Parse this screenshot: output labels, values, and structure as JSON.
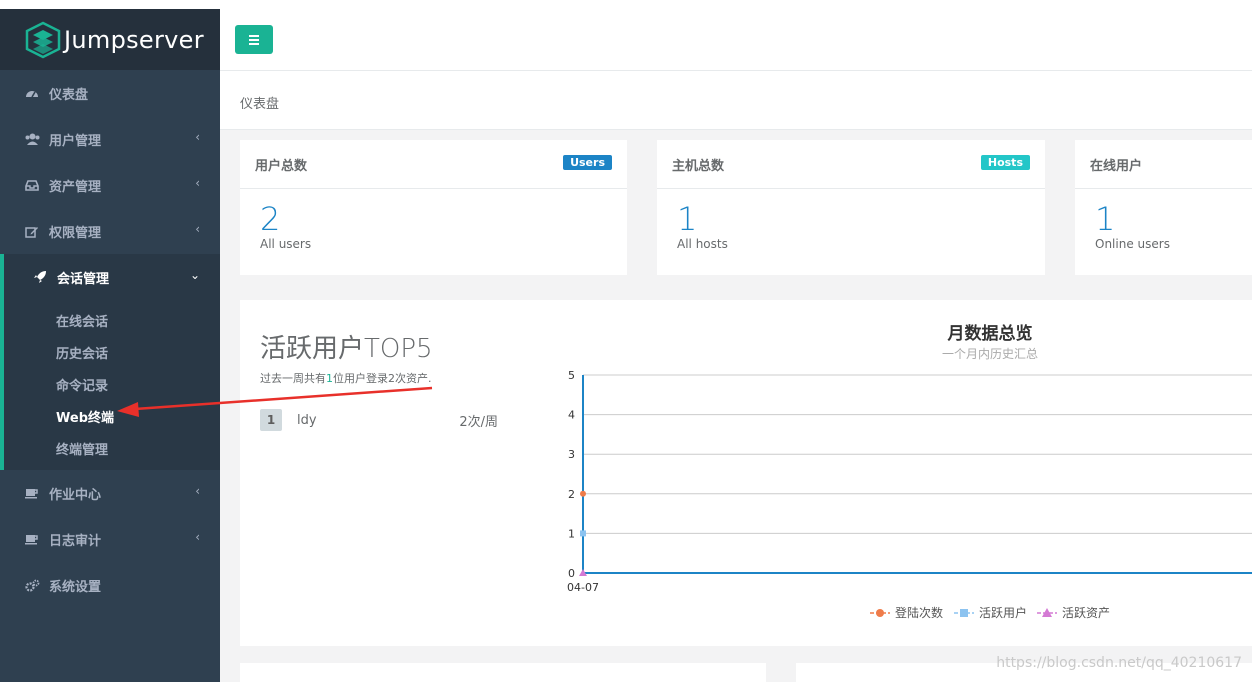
{
  "brand": {
    "name": "Jumpserver"
  },
  "sidebar": {
    "items": [
      {
        "label": "仪表盘",
        "icon": "dashboard-icon"
      },
      {
        "label": "用户管理",
        "icon": "users-icon"
      },
      {
        "label": "资产管理",
        "icon": "inbox-icon"
      },
      {
        "label": "权限管理",
        "icon": "edit-icon"
      },
      {
        "label": "会话管理",
        "icon": "rocket-icon"
      },
      {
        "label": "作业中心",
        "icon": "coffee-icon"
      },
      {
        "label": "日志审计",
        "icon": "log-icon"
      },
      {
        "label": "系统设置",
        "icon": "gears-icon"
      }
    ],
    "sub_items": [
      "在线会话",
      "历史会话",
      "命令记录",
      "Web终端",
      "终端管理"
    ],
    "chevron": "‹",
    "chevron_open": "⌄"
  },
  "breadcrumb": "仪表盘",
  "cards": [
    {
      "title": "用户总数",
      "badge": "Users",
      "badge_color": "#1c84c6",
      "value": "2",
      "label": "All users"
    },
    {
      "title": "主机总数",
      "badge": "Hosts",
      "badge_color": "#23c6c8",
      "value": "1",
      "label": "All hosts"
    },
    {
      "title": "在线用户",
      "value": "1",
      "label": "Online users"
    }
  ],
  "top5": {
    "title": "活跃用户TOP5",
    "sub_prefix": "过去一周共有",
    "sub_count": "1",
    "sub_suffix": "位用户登录2次资产.",
    "rows": [
      {
        "rank": "1",
        "name": "ldy",
        "value": "2次/周"
      }
    ]
  },
  "chart_data": {
    "type": "line",
    "title": "月数据总览",
    "subtitle": "一个月内历史汇总",
    "x": [
      "04-07"
    ],
    "ylim": [
      0,
      5
    ],
    "yticks": [
      0,
      1,
      2,
      3,
      4,
      5
    ],
    "grid": true,
    "legend_position": "bottom",
    "series": [
      {
        "name": "登陆次数",
        "values": [
          2
        ],
        "color": "#ef7c4a",
        "marker": "circle"
      },
      {
        "name": "活跃用户",
        "values": [
          1
        ],
        "color": "#8cc3f0",
        "marker": "square"
      },
      {
        "name": "活跃资产",
        "values": [
          0
        ],
        "color": "#d47ad4",
        "marker": "triangle"
      }
    ]
  },
  "watermark": "https://blog.csdn.net/qq_40210617"
}
